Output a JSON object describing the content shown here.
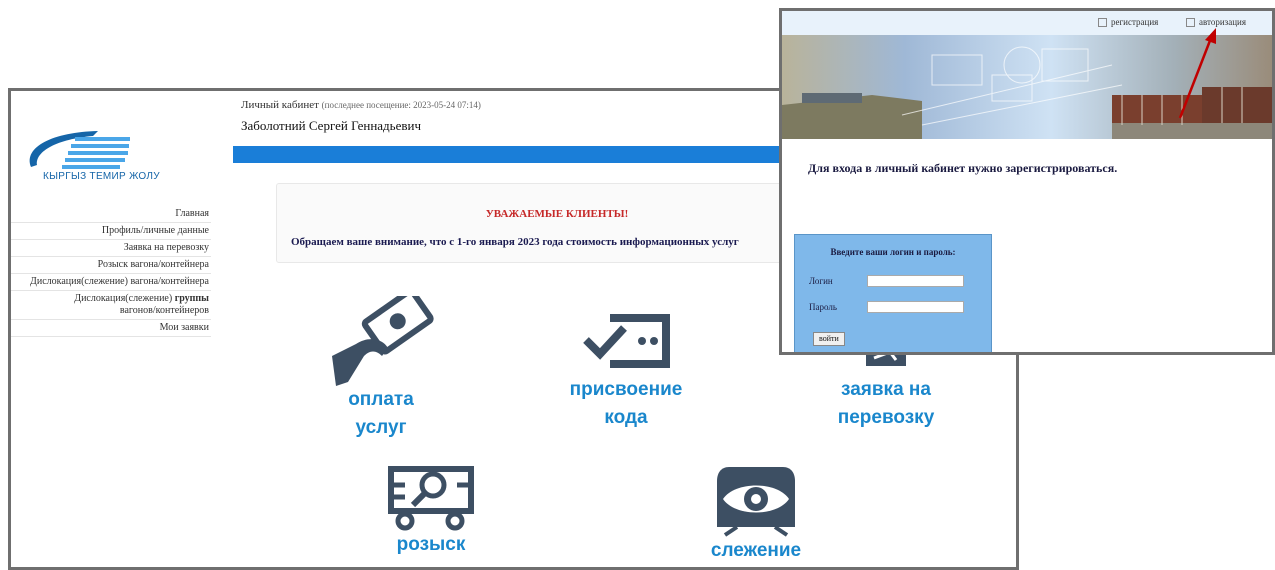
{
  "logo": {
    "text": "КЫРГЫЗ ТЕМИР ЖОЛУ"
  },
  "header": {
    "cabinet_label": "Личный кабинет",
    "last_visit": "(последнее посещение: 2023-05-24 07:14)",
    "user_name": "Заболотний Сергей Геннадьевич"
  },
  "menu": {
    "items": [
      {
        "label": "Главная"
      },
      {
        "label": "Профиль/личные данные"
      },
      {
        "label": "Заявка на перевозку"
      },
      {
        "label": "Розыск вагона/контейнера"
      },
      {
        "label": "Дислокация(слежение) вагона/контейнера"
      },
      {
        "label_part1": "Дислокация(слежение)",
        "label_part2": "группы",
        "label_part3": "вагонов/контейнеров"
      },
      {
        "label": "Мои заявки"
      }
    ]
  },
  "notice": {
    "title": "УВАЖАЕМЫЕ КЛИЕНТЫ!",
    "text": "Обращаем ваше внимание, что с 1-го января 2023 года стоимость информационных услуг"
  },
  "tiles": {
    "payment": {
      "line1": "оплата",
      "line2": "услуг",
      "icon": "payment-icon"
    },
    "code": {
      "line1": "присвоение",
      "line2": "кода",
      "icon": "ticket-check-icon"
    },
    "request": {
      "line1": "заявка на",
      "line2": "перевозку",
      "icon": "request-icon"
    },
    "search": {
      "line1": "розыск",
      "icon": "wagon-search-icon"
    },
    "tracking": {
      "line1": "слежение",
      "icon": "train-eye-icon"
    }
  },
  "overlay": {
    "register_link": "регистрация",
    "auth_link": "авторизация",
    "message": "Для входа в личный кабинет нужно зарегистрироваться.",
    "login_panel": {
      "title": "Введите ваши логин и пароль:",
      "login_label": "Логин",
      "password_label": "Пароль",
      "submit_label": "войти"
    }
  },
  "colors": {
    "accent_blue": "#1a7ed8",
    "tile_blue": "#1a87cc",
    "icon_dark": "#3d4f63",
    "notice_red": "#c62828",
    "arrow_red": "#c00000",
    "login_panel_bg": "#7fb8ea"
  }
}
